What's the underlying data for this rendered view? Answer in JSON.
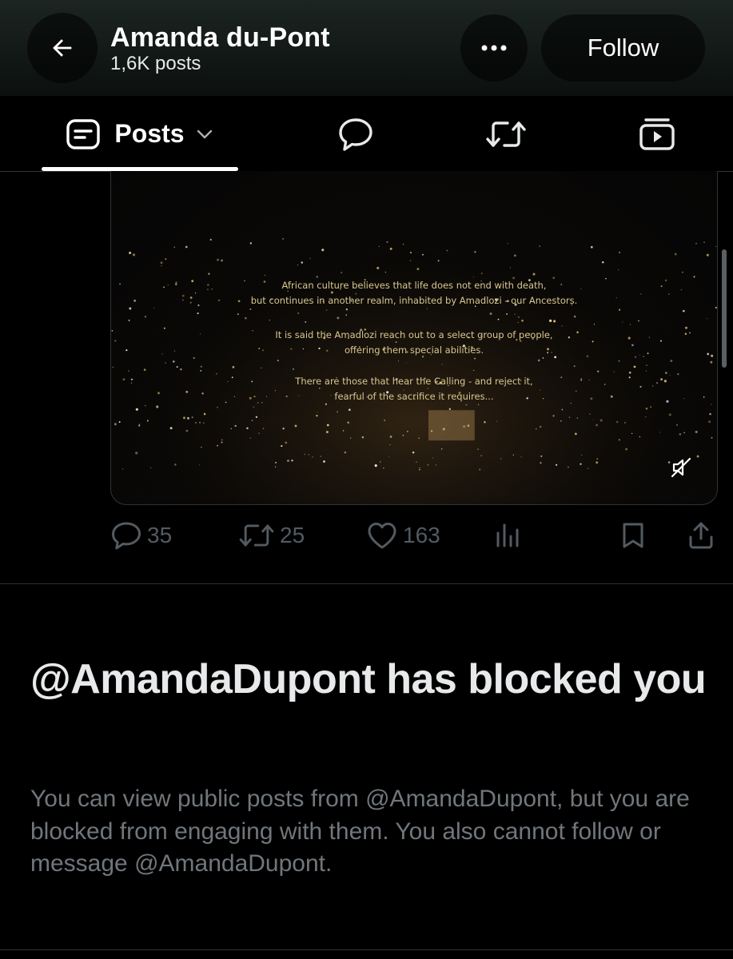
{
  "header": {
    "title": "Amanda du-Pont",
    "subtitle": "1,6K posts",
    "follow_label": "Follow",
    "back_icon": "arrow-left-icon",
    "more_icon": "more-horizontal-icon"
  },
  "tabs": {
    "posts_label": "Posts",
    "posts_icon": "posts-list-icon",
    "replies_icon": "reply-bubble-icon",
    "reposts_icon": "repost-icon",
    "media_icon": "video-play-icon"
  },
  "media": {
    "caption_lines": [
      "African culture believes that life does not end with death,",
      "but continues in another realm, inhabited by Amadlozi - our Ancestors.",
      "It is said the Amadlozi reach out to a select group of people,",
      "offering them special abilities.",
      "There are those that hear the Calling - and reject it,",
      "fearful of the sacrifice it requires..."
    ],
    "mute_icon": "speaker-muted-icon"
  },
  "actions": {
    "replies": "35",
    "reposts": "25",
    "likes": "163"
  },
  "blocked": {
    "title": "@AmandaDupont has blocked you",
    "description": "You can view public posts from @AmandaDupont, but you are blocked from engaging with them. You also cannot follow or message @AmandaDupont."
  },
  "colors": {
    "background": "#000000",
    "text_primary": "#e7e9ea",
    "text_secondary": "#71767b",
    "action_icon": "#535a60",
    "caption": "#d8c890"
  }
}
